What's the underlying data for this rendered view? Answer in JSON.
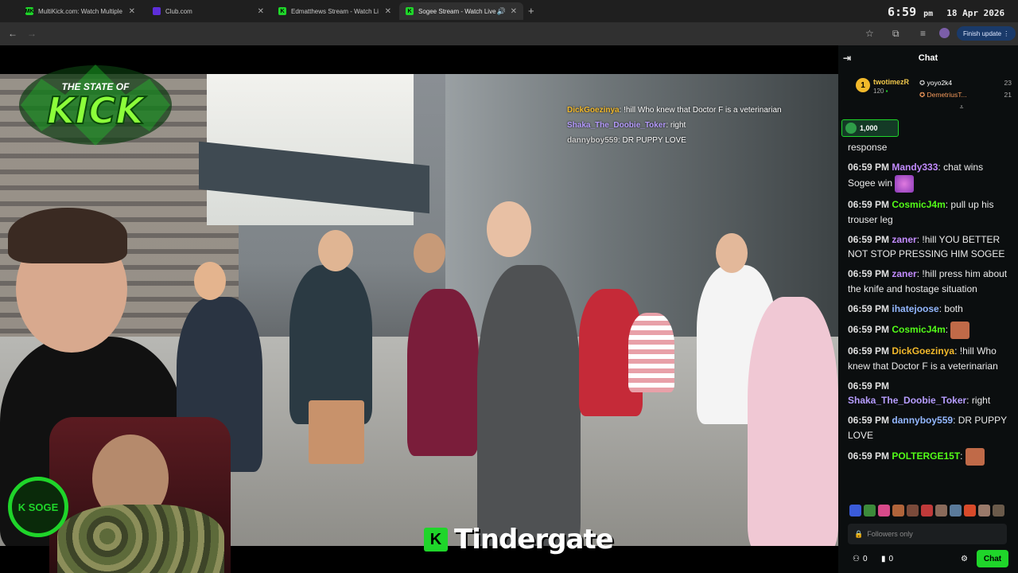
{
  "browser": {
    "tabs": [
      {
        "label": "MultiKick.com: Watch Multiple",
        "favicon": "MK",
        "color": "#1fd52a"
      },
      {
        "label": "Club.com",
        "favicon": "",
        "color": "#5d2ed9"
      },
      {
        "label": "Edmatthews Stream - Watch Li",
        "favicon": "K",
        "color": "#1fd52a"
      },
      {
        "label": "Sogee Stream - Watch Live",
        "favicon": "K",
        "color": "#1fd52a"
      }
    ],
    "clock": {
      "time": "6:59",
      "ampm": "pm",
      "date": "18 Apr 2026"
    },
    "finish_update": "Finish update"
  },
  "stream": {
    "logo_text": "THE STATE OF KICK",
    "cam_logo_text": "K SOGE",
    "title": "Tindergate",
    "overlay_chat": [
      {
        "user": "DickGoezinya",
        "color": "#f2b92b",
        "text": ": !hill Who knew that Doctor F is a veterinarian"
      },
      {
        "user": "Shaka_The_Doobie_Toker",
        "color": "#b79dff",
        "text": ": right"
      },
      {
        "user": "dannyboy559",
        "color": "#cfcfcf",
        "text": ": DR PUPPY LOVE"
      }
    ]
  },
  "chat": {
    "header": "Chat",
    "leaderboard": {
      "first": {
        "rank": "1",
        "name": "twotimezR",
        "count": "120"
      },
      "others": [
        {
          "name": "yoyo2k4",
          "count": "23"
        },
        {
          "name": "DemetriusT...",
          "count": "21"
        }
      ]
    },
    "gift_amount": "1,000",
    "messages": [
      {
        "time": "",
        "user": "",
        "color": "#fff",
        "text": "response"
      },
      {
        "time": "06:59 PM",
        "user": "Mandy333",
        "color": "#c38cff",
        "text": ": chat wins Sogee win",
        "emote": "hearts"
      },
      {
        "time": "06:59 PM",
        "user": "CosmicJ4m",
        "color": "#53fc18",
        "text": ": pull up his trouser leg"
      },
      {
        "time": "06:59 PM",
        "user": "zaner",
        "color": "#c38cff",
        "text": ": !hill YOU BETTER NOT STOP PRESSING HIM SOGEE"
      },
      {
        "time": "06:59 PM",
        "user": "zaner",
        "color": "#c38cff",
        "text": ": !hill press him about the knife and hostage situation"
      },
      {
        "time": "06:59 PM",
        "user": "ihatejoose",
        "color": "#93b7ff",
        "text": ": both"
      },
      {
        "time": "06:59 PM",
        "user": "CosmicJ4m",
        "color": "#53fc18",
        "text": ":",
        "emote": "face"
      },
      {
        "time": "06:59 PM",
        "user": "DickGoezinya",
        "color": "#f2b92b",
        "text": ": !hill Who knew that Doctor F is a veterinarian"
      },
      {
        "time": "06:59 PM",
        "user": "Shaka_The_Doobie_Toker",
        "color": "#b79dff",
        "text": ": right",
        "break": true
      },
      {
        "time": "06:59 PM",
        "user": "dannyboy559",
        "color": "#93b7ff",
        "text": ": DR PUPPY LOVE"
      },
      {
        "time": "06:59 PM",
        "user": "POLTERGE15T",
        "color": "#53fc18",
        "text": ":",
        "emote": "face"
      }
    ],
    "input_placeholder": "Followers only",
    "footer": {
      "points": "0",
      "gifts": "0",
      "send_label": "Chat"
    }
  }
}
